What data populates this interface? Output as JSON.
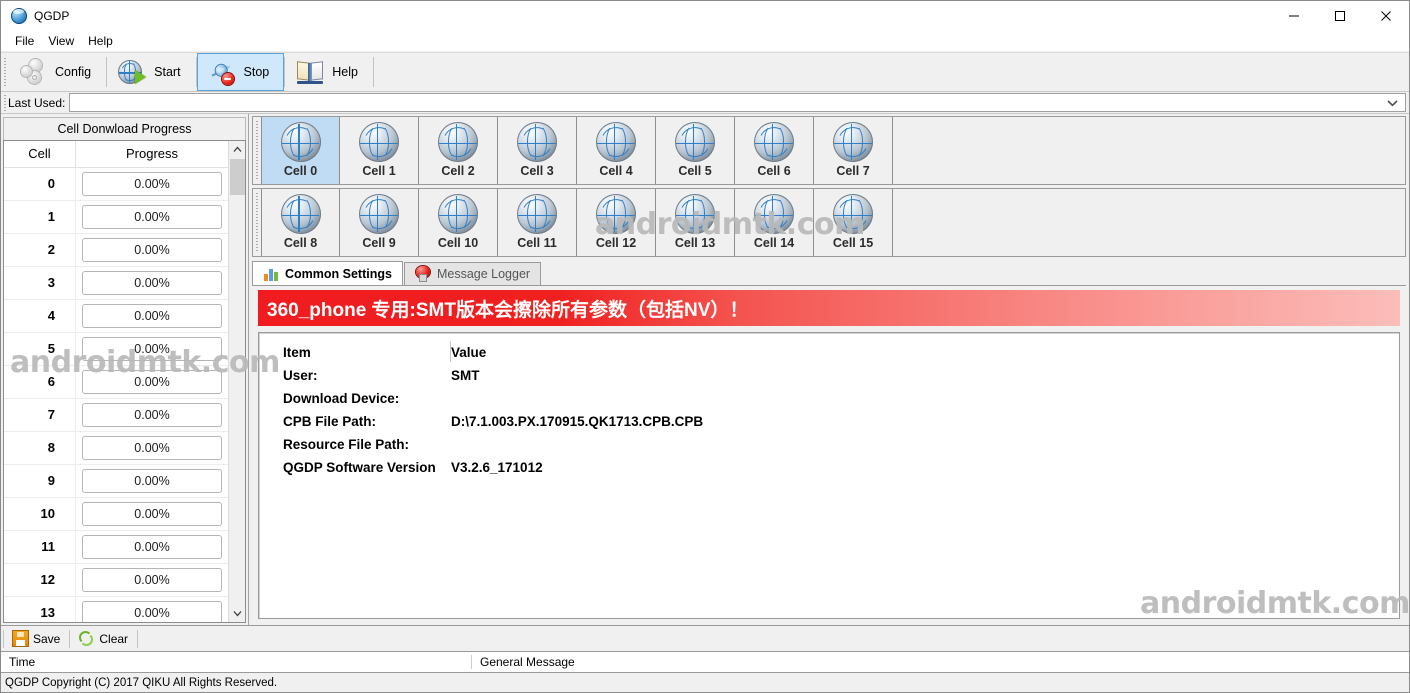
{
  "window": {
    "title": "QGDP",
    "app_icon": "globe-icon",
    "controls": {
      "minimize": "minimize-icon",
      "maximize": "maximize-icon",
      "close": "close-icon"
    }
  },
  "menubar": {
    "items": [
      "File",
      "View",
      "Help"
    ]
  },
  "toolbar": {
    "buttons": [
      {
        "label": "Config",
        "icon": "gears-icon",
        "active": false
      },
      {
        "label": "Start",
        "icon": "globe-play-icon",
        "active": false
      },
      {
        "label": "Stop",
        "icon": "spinner-stop-icon",
        "active": true
      },
      {
        "label": "Help",
        "icon": "open-book-icon",
        "active": false
      }
    ]
  },
  "last_used": {
    "label": "Last Used:",
    "value": "",
    "placeholder": "",
    "chevron": "chevron-down-icon"
  },
  "left_panel": {
    "group_title": "Cell Donwload Progress",
    "columns": [
      "Cell",
      "Progress"
    ],
    "rows": [
      {
        "cell": "0",
        "progress": "0.00%"
      },
      {
        "cell": "1",
        "progress": "0.00%"
      },
      {
        "cell": "2",
        "progress": "0.00%"
      },
      {
        "cell": "3",
        "progress": "0.00%"
      },
      {
        "cell": "4",
        "progress": "0.00%"
      },
      {
        "cell": "5",
        "progress": "0.00%"
      },
      {
        "cell": "6",
        "progress": "0.00%"
      },
      {
        "cell": "7",
        "progress": "0.00%"
      },
      {
        "cell": "8",
        "progress": "0.00%"
      },
      {
        "cell": "9",
        "progress": "0.00%"
      },
      {
        "cell": "10",
        "progress": "0.00%"
      },
      {
        "cell": "11",
        "progress": "0.00%"
      },
      {
        "cell": "12",
        "progress": "0.00%"
      },
      {
        "cell": "13",
        "progress": "0.00%"
      }
    ],
    "scrollbar": {
      "up": "chevron-up-icon",
      "down": "chevron-down-icon"
    }
  },
  "cells": {
    "row1": [
      {
        "label": "Cell 0",
        "icon": "globe-icon",
        "selected": true
      },
      {
        "label": "Cell 1",
        "icon": "globe-icon",
        "selected": false
      },
      {
        "label": "Cell 2",
        "icon": "globe-icon",
        "selected": false
      },
      {
        "label": "Cell 3",
        "icon": "globe-icon",
        "selected": false
      },
      {
        "label": "Cell 4",
        "icon": "globe-icon",
        "selected": false
      },
      {
        "label": "Cell 5",
        "icon": "globe-icon",
        "selected": false
      },
      {
        "label": "Cell 6",
        "icon": "globe-icon",
        "selected": false
      },
      {
        "label": "Cell 7",
        "icon": "globe-icon",
        "selected": false
      }
    ],
    "row2": [
      {
        "label": "Cell 8",
        "icon": "globe-icon",
        "selected": false
      },
      {
        "label": "Cell 9",
        "icon": "globe-icon",
        "selected": false
      },
      {
        "label": "Cell 10",
        "icon": "globe-icon",
        "selected": false
      },
      {
        "label": "Cell 11",
        "icon": "globe-icon",
        "selected": false
      },
      {
        "label": "Cell 12",
        "icon": "globe-icon",
        "selected": false
      },
      {
        "label": "Cell 13",
        "icon": "globe-icon",
        "selected": false
      },
      {
        "label": "Cell 14",
        "icon": "globe-icon",
        "selected": false
      },
      {
        "label": "Cell 15",
        "icon": "globe-icon",
        "selected": false
      }
    ]
  },
  "tabs": [
    {
      "label": "Common Settings",
      "icon": "bar-chart-icon",
      "active": true
    },
    {
      "label": "Message Logger",
      "icon": "red-bulb-icon",
      "active": false
    }
  ],
  "common_settings": {
    "warning": "360_phone 专用:SMT版本会擦除所有参数（包括NV）！",
    "warning_color": "#f01c20",
    "table": {
      "headers": {
        "item": "Item",
        "value": "Value"
      },
      "rows": [
        {
          "item": "User:",
          "value": "SMT"
        },
        {
          "item": "Download Device:",
          "value": ""
        },
        {
          "item": "CPB File Path:",
          "value": "D:\\7.1.003.PX.170915.QK1713.CPB.CPB"
        },
        {
          "item": "Resource File Path:",
          "value": ""
        },
        {
          "item": "QGDP Software Version",
          "value": "V3.2.6_171012"
        }
      ]
    }
  },
  "log_toolbar": {
    "save": {
      "label": "Save",
      "icon": "floppy-save-icon"
    },
    "clear": {
      "label": "Clear",
      "icon": "recycle-clear-icon"
    }
  },
  "log_table": {
    "headers": [
      "Time",
      "General Message"
    ],
    "rows": []
  },
  "statusbar": {
    "text": "QGDP Copyright (C) 2017 QIKU All Rights Reserved."
  },
  "watermarks": {
    "text": "androidmtk.com"
  }
}
